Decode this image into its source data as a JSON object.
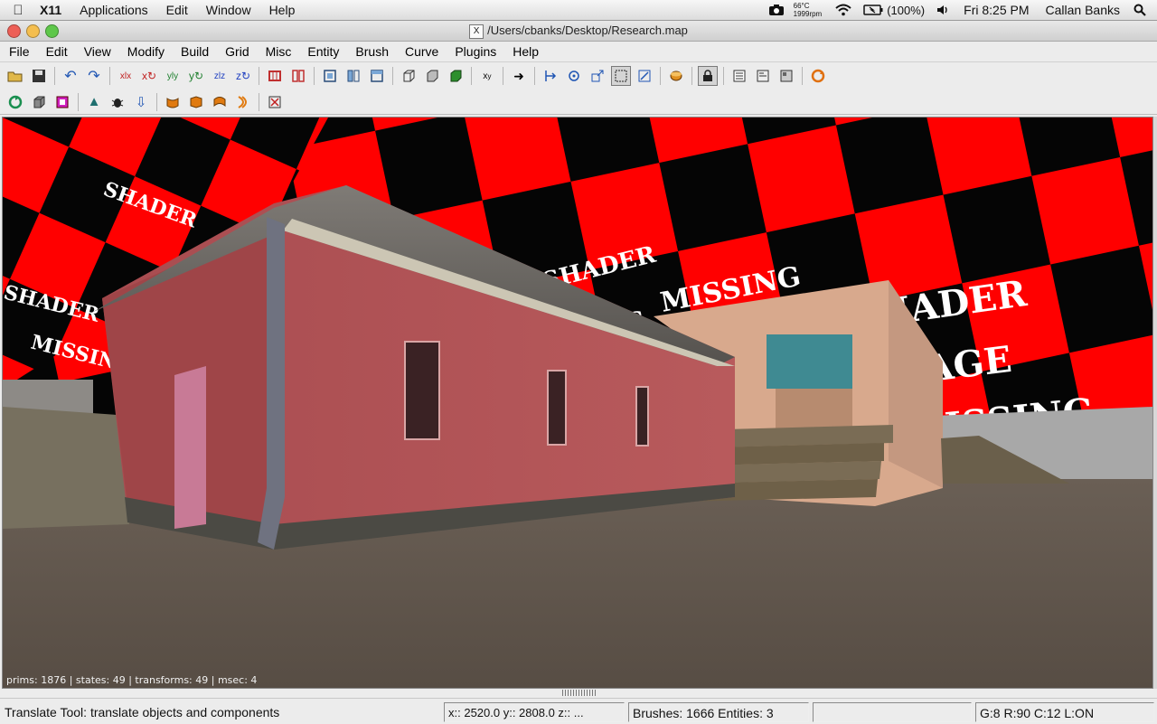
{
  "os_menubar": {
    "app_name": "X11",
    "items": [
      "Applications",
      "Edit",
      "Window",
      "Help"
    ],
    "temperature": "66°C",
    "fan_speed": "1999rpm",
    "battery": "(100%)",
    "clock": "Fri 8:25 PM",
    "user": "Callan Banks"
  },
  "window": {
    "title": "/Users/cbanks/Desktop/Research.map"
  },
  "app_menu": [
    "File",
    "Edit",
    "View",
    "Modify",
    "Build",
    "Grid",
    "Misc",
    "Entity",
    "Brush",
    "Curve",
    "Plugins",
    "Help"
  ],
  "viewport": {
    "render_stats": "prims: 1876 | states: 49 | transforms: 49 | msec: 4",
    "shader_words": [
      "SHADER",
      "IMAGE",
      "MISSING"
    ]
  },
  "statusbar": {
    "help_text": "Translate Tool: translate objects and components",
    "coords": "x:: 2520.0  y:: 2808.0  z::   ...",
    "counts": "Brushes: 1666 Entities: 3",
    "grid_info": "G:8  R:90  C:12  L:ON"
  },
  "colors": {
    "shader_red": "#ff0000",
    "shader_black": "#050505",
    "wall_red": "#b25457",
    "plaster": "#d9aa8f",
    "ground": "#5e544b"
  }
}
